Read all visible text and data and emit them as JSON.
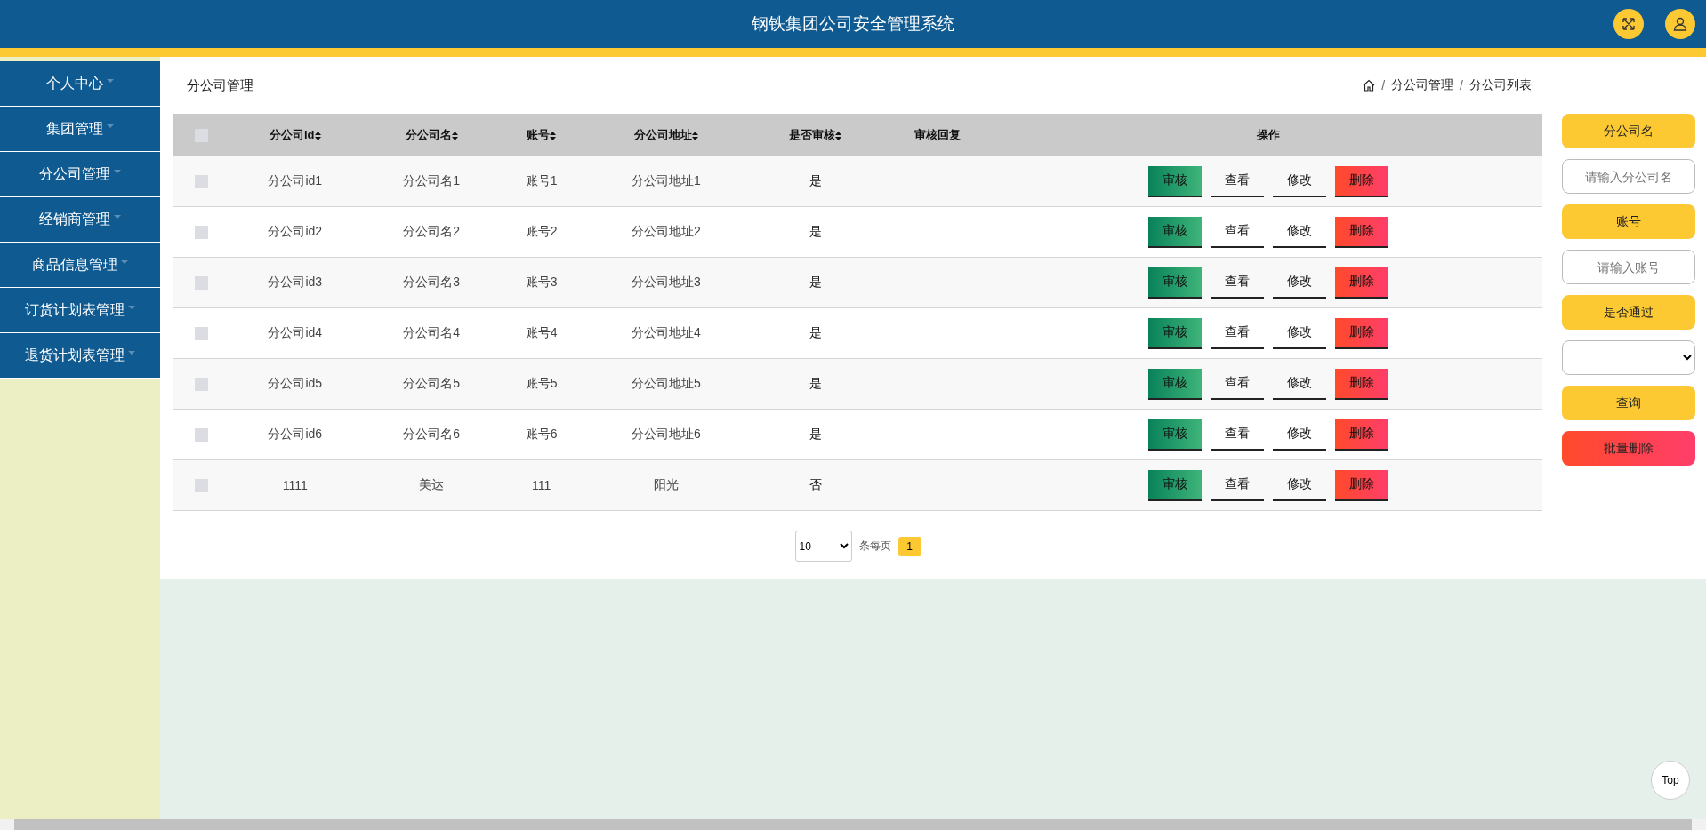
{
  "header": {
    "title": "钢铁集团公司安全管理系统"
  },
  "sidebar": {
    "items": [
      {
        "label": "个人中心"
      },
      {
        "label": "集团管理"
      },
      {
        "label": "分公司管理"
      },
      {
        "label": "经销商管理"
      },
      {
        "label": "商品信息管理"
      },
      {
        "label": "订货计划表管理"
      },
      {
        "label": "退货计划表管理"
      }
    ]
  },
  "page_title": "分公司管理",
  "breadcrumb": [
    {
      "kind": "sep",
      "text": "/"
    },
    {
      "kind": "link",
      "text": "分公司管理"
    },
    {
      "kind": "sep",
      "text": "/"
    },
    {
      "kind": "link",
      "text": "分公司列表"
    }
  ],
  "table": {
    "select_all": {
      "checked": false
    },
    "columns": [
      {
        "label": "分公司id",
        "sortable": true
      },
      {
        "label": "分公司名",
        "sortable": true
      },
      {
        "label": "账号",
        "sortable": true
      },
      {
        "label": "分公司地址",
        "sortable": true
      },
      {
        "label": "是否审核",
        "sortable": true
      },
      {
        "label": "审核回复",
        "sortable": false
      },
      {
        "label": "操作",
        "sortable": false
      }
    ],
    "rows": [
      {
        "checked": false,
        "cells": [
          "分公司id1",
          "分公司名1",
          "账号1",
          "分公司地址1",
          "是"
        ],
        "actions": [
          {
            "label": "审核",
            "kind": "audit"
          },
          {
            "label": "查看",
            "kind": "plain"
          },
          {
            "label": "修改",
            "kind": "plain"
          },
          {
            "label": "删除",
            "kind": "danger"
          }
        ]
      },
      {
        "checked": false,
        "cells": [
          "分公司id2",
          "分公司名2",
          "账号2",
          "分公司地址2",
          "是"
        ],
        "actions": [
          {
            "label": "审核",
            "kind": "audit"
          },
          {
            "label": "查看",
            "kind": "plain"
          },
          {
            "label": "修改",
            "kind": "plain"
          },
          {
            "label": "删除",
            "kind": "danger"
          }
        ]
      },
      {
        "checked": false,
        "cells": [
          "分公司id3",
          "分公司名3",
          "账号3",
          "分公司地址3",
          "是"
        ],
        "actions": [
          {
            "label": "审核",
            "kind": "audit"
          },
          {
            "label": "查看",
            "kind": "plain"
          },
          {
            "label": "修改",
            "kind": "plain"
          },
          {
            "label": "删除",
            "kind": "danger"
          }
        ]
      },
      {
        "checked": false,
        "cells": [
          "分公司id4",
          "分公司名4",
          "账号4",
          "分公司地址4",
          "是"
        ],
        "actions": [
          {
            "label": "审核",
            "kind": "audit"
          },
          {
            "label": "查看",
            "kind": "plain"
          },
          {
            "label": "修改",
            "kind": "plain"
          },
          {
            "label": "删除",
            "kind": "danger"
          }
        ]
      },
      {
        "checked": false,
        "cells": [
          "分公司id5",
          "分公司名5",
          "账号5",
          "分公司地址5",
          "是"
        ],
        "actions": [
          {
            "label": "审核",
            "kind": "audit"
          },
          {
            "label": "查看",
            "kind": "plain"
          },
          {
            "label": "修改",
            "kind": "plain"
          },
          {
            "label": "删除",
            "kind": "danger"
          }
        ]
      },
      {
        "checked": false,
        "cells": [
          "分公司id6",
          "分公司名6",
          "账号6",
          "分公司地址6",
          "是"
        ],
        "actions": [
          {
            "label": "审核",
            "kind": "audit"
          },
          {
            "label": "查看",
            "kind": "plain"
          },
          {
            "label": "修改",
            "kind": "plain"
          },
          {
            "label": "删除",
            "kind": "danger"
          }
        ]
      },
      {
        "checked": false,
        "cells": [
          "1111",
          "美达",
          "111",
          "阳光",
          "否"
        ],
        "actions": [
          {
            "label": "审核",
            "kind": "audit"
          },
          {
            "label": "查看",
            "kind": "plain"
          },
          {
            "label": "修改",
            "kind": "plain"
          },
          {
            "label": "删除",
            "kind": "danger"
          }
        ]
      }
    ]
  },
  "pagination": {
    "page_size": "10",
    "per_page_label": "条每页",
    "pages": [
      {
        "label": "1",
        "selected": true
      }
    ]
  },
  "filters": [
    {
      "kind": "label",
      "text": "分公司名"
    },
    {
      "kind": "input",
      "placeholder": "请输入分公司名"
    },
    {
      "kind": "label",
      "text": "账号"
    },
    {
      "kind": "input",
      "placeholder": "请输入账号"
    },
    {
      "kind": "label",
      "text": "是否通过"
    },
    {
      "kind": "select"
    },
    {
      "kind": "button",
      "text": "查询"
    },
    {
      "kind": "danger",
      "text": "批量删除"
    }
  ],
  "top_button": "Top"
}
